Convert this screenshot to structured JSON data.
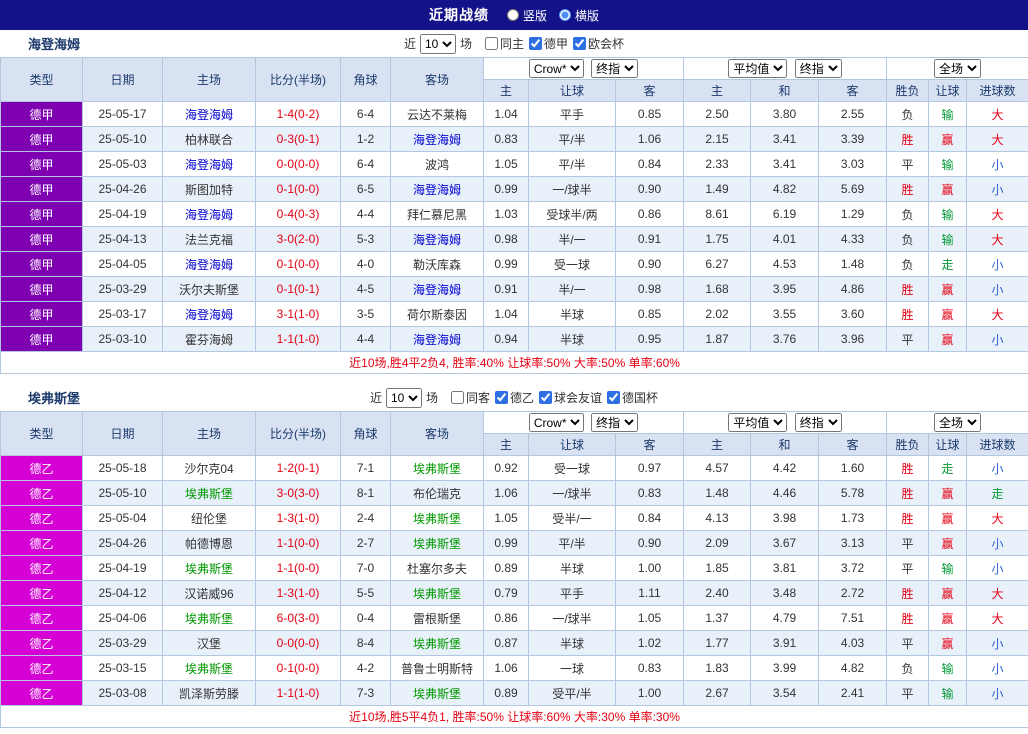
{
  "topbar": {
    "title": "近期战绩",
    "layout_options": [
      "竖版",
      "横版"
    ],
    "selected": "横版"
  },
  "colors": {
    "topbar_bg": "#141289",
    "score": "#e60012",
    "summary_text": "#e60012",
    "league_badge": {
      "德甲": "#7e00b0",
      "德乙": "#d400d4"
    },
    "team_highlight": {
      "海登海姆": "#0000d0",
      "埃弗斯堡": "#009900"
    },
    "outcome": {
      "胜": "#e60012",
      "平": "#333333",
      "负": "#333333",
      "赢": "#e60012",
      "输": "#009933",
      "走": "#009933",
      "大": "#e60012",
      "小": "#2d62d8"
    }
  },
  "table_header": {
    "col_type": "类型",
    "col_date": "日期",
    "col_home": "主场",
    "col_score": "比分(半场)",
    "col_corner": "角球",
    "col_away": "客场",
    "odds_cols": [
      "主",
      "让球",
      "客"
    ],
    "avg_cols": [
      "主",
      "和",
      "客"
    ],
    "result_cols": [
      "胜负",
      "让球",
      "进球数"
    ],
    "dd_odds_source": "Crow*",
    "dd_odds_stage": "终指",
    "dd_avg": "平均值",
    "dd_avg_stage": "终指",
    "dd_scope": "全场"
  },
  "sections": [
    {
      "team": "海登海姆",
      "filter": {
        "prefix": "近",
        "count": "10",
        "suffix": "场",
        "checkboxes": [
          {
            "label": "同主",
            "checked": false
          },
          {
            "label": "德甲",
            "checked": true
          },
          {
            "label": "欧会杯",
            "checked": true
          }
        ]
      },
      "rows": [
        {
          "league": "德甲",
          "date": "25-05-17",
          "home": "海登海姆",
          "score": "1-4(0-2)",
          "corner": "6-4",
          "away": "云达不莱梅",
          "odds": [
            "1.04",
            "平手",
            "0.85"
          ],
          "avg": [
            "2.50",
            "3.80",
            "2.55"
          ],
          "result": "负",
          "handicap": "输",
          "goal": "大"
        },
        {
          "league": "德甲",
          "date": "25-05-10",
          "home": "柏林联合",
          "score": "0-3(0-1)",
          "corner": "1-2",
          "away": "海登海姆",
          "odds": [
            "0.83",
            "平/半",
            "1.06"
          ],
          "avg": [
            "2.15",
            "3.41",
            "3.39"
          ],
          "result": "胜",
          "handicap": "赢",
          "goal": "大"
        },
        {
          "league": "德甲",
          "date": "25-05-03",
          "home": "海登海姆",
          "score": "0-0(0-0)",
          "corner": "6-4",
          "away": "波鸿",
          "odds": [
            "1.05",
            "平/半",
            "0.84"
          ],
          "avg": [
            "2.33",
            "3.41",
            "3.03"
          ],
          "result": "平",
          "handicap": "输",
          "goal": "小"
        },
        {
          "league": "德甲",
          "date": "25-04-26",
          "home": "斯图加特",
          "score": "0-1(0-0)",
          "corner": "6-5",
          "away": "海登海姆",
          "odds": [
            "0.99",
            "一/球半",
            "0.90"
          ],
          "avg": [
            "1.49",
            "4.82",
            "5.69"
          ],
          "result": "胜",
          "handicap": "赢",
          "goal": "小"
        },
        {
          "league": "德甲",
          "date": "25-04-19",
          "home": "海登海姆",
          "score": "0-4(0-3)",
          "corner": "4-4",
          "away": "拜仁慕尼黑",
          "odds": [
            "1.03",
            "受球半/两",
            "0.86"
          ],
          "avg": [
            "8.61",
            "6.19",
            "1.29"
          ],
          "result": "负",
          "handicap": "输",
          "goal": "大"
        },
        {
          "league": "德甲",
          "date": "25-04-13",
          "home": "法兰克福",
          "score": "3-0(2-0)",
          "corner": "5-3",
          "away": "海登海姆",
          "odds": [
            "0.98",
            "半/一",
            "0.91"
          ],
          "avg": [
            "1.75",
            "4.01",
            "4.33"
          ],
          "result": "负",
          "handicap": "输",
          "goal": "大"
        },
        {
          "league": "德甲",
          "date": "25-04-05",
          "home": "海登海姆",
          "score": "0-1(0-0)",
          "corner": "4-0",
          "away": "勒沃库森",
          "odds": [
            "0.99",
            "受一球",
            "0.90"
          ],
          "avg": [
            "6.27",
            "4.53",
            "1.48"
          ],
          "result": "负",
          "handicap": "走",
          "goal": "小"
        },
        {
          "league": "德甲",
          "date": "25-03-29",
          "home": "沃尔夫斯堡",
          "score": "0-1(0-1)",
          "corner": "4-5",
          "away": "海登海姆",
          "odds": [
            "0.91",
            "半/一",
            "0.98"
          ],
          "avg": [
            "1.68",
            "3.95",
            "4.86"
          ],
          "result": "胜",
          "handicap": "赢",
          "goal": "小"
        },
        {
          "league": "德甲",
          "date": "25-03-17",
          "home": "海登海姆",
          "score": "3-1(1-0)",
          "corner": "3-5",
          "away": "荷尔斯泰因",
          "odds": [
            "1.04",
            "半球",
            "0.85"
          ],
          "avg": [
            "2.02",
            "3.55",
            "3.60"
          ],
          "result": "胜",
          "handicap": "赢",
          "goal": "大"
        },
        {
          "league": "德甲",
          "date": "25-03-10",
          "home": "霍芬海姆",
          "score": "1-1(1-0)",
          "corner": "4-4",
          "away": "海登海姆",
          "odds": [
            "0.94",
            "半球",
            "0.95"
          ],
          "avg": [
            "1.87",
            "3.76",
            "3.96"
          ],
          "result": "平",
          "handicap": "赢",
          "goal": "小"
        }
      ],
      "summary": "近10场,胜4平2负4, 胜率:40% 让球率:50% 大率:50% 单率:60%"
    },
    {
      "team": "埃弗斯堡",
      "filter": {
        "prefix": "近",
        "count": "10",
        "suffix": "场",
        "checkboxes": [
          {
            "label": "同客",
            "checked": false
          },
          {
            "label": "德乙",
            "checked": true
          },
          {
            "label": "球会友谊",
            "checked": true
          },
          {
            "label": "德国杯",
            "checked": true
          }
        ]
      },
      "rows": [
        {
          "league": "德乙",
          "date": "25-05-18",
          "home": "沙尔克04",
          "score": "1-2(0-1)",
          "corner": "7-1",
          "away": "埃弗斯堡",
          "odds": [
            "0.92",
            "受一球",
            "0.97"
          ],
          "avg": [
            "4.57",
            "4.42",
            "1.60"
          ],
          "result": "胜",
          "handicap": "走",
          "goal": "小"
        },
        {
          "league": "德乙",
          "date": "25-05-10",
          "home": "埃弗斯堡",
          "score": "3-0(3-0)",
          "corner": "8-1",
          "away": "布伦瑞克",
          "odds": [
            "1.06",
            "一/球半",
            "0.83"
          ],
          "avg": [
            "1.48",
            "4.46",
            "5.78"
          ],
          "result": "胜",
          "handicap": "赢",
          "goal": "走"
        },
        {
          "league": "德乙",
          "date": "25-05-04",
          "home": "纽伦堡",
          "score": "1-3(1-0)",
          "corner": "2-4",
          "away": "埃弗斯堡",
          "odds": [
            "1.05",
            "受半/一",
            "0.84"
          ],
          "avg": [
            "4.13",
            "3.98",
            "1.73"
          ],
          "result": "胜",
          "handicap": "赢",
          "goal": "大"
        },
        {
          "league": "德乙",
          "date": "25-04-26",
          "home": "帕德博恩",
          "score": "1-1(0-0)",
          "corner": "2-7",
          "away": "埃弗斯堡",
          "odds": [
            "0.99",
            "平/半",
            "0.90"
          ],
          "avg": [
            "2.09",
            "3.67",
            "3.13"
          ],
          "result": "平",
          "handicap": "赢",
          "goal": "小"
        },
        {
          "league": "德乙",
          "date": "25-04-19",
          "home": "埃弗斯堡",
          "score": "1-1(0-0)",
          "corner": "7-0",
          "away": "杜塞尔多夫",
          "odds": [
            "0.89",
            "半球",
            "1.00"
          ],
          "avg": [
            "1.85",
            "3.81",
            "3.72"
          ],
          "result": "平",
          "handicap": "输",
          "goal": "小"
        },
        {
          "league": "德乙",
          "date": "25-04-12",
          "home": "汉诺威96",
          "score": "1-3(1-0)",
          "corner": "5-5",
          "away": "埃弗斯堡",
          "odds": [
            "0.79",
            "平手",
            "1.11"
          ],
          "avg": [
            "2.40",
            "3.48",
            "2.72"
          ],
          "result": "胜",
          "handicap": "赢",
          "goal": "大"
        },
        {
          "league": "德乙",
          "date": "25-04-06",
          "home": "埃弗斯堡",
          "score": "6-0(3-0)",
          "corner": "0-4",
          "away": "雷根斯堡",
          "odds": [
            "0.86",
            "一/球半",
            "1.05"
          ],
          "avg": [
            "1.37",
            "4.79",
            "7.51"
          ],
          "result": "胜",
          "handicap": "赢",
          "goal": "大"
        },
        {
          "league": "德乙",
          "date": "25-03-29",
          "home": "汉堡",
          "score": "0-0(0-0)",
          "corner": "8-4",
          "away": "埃弗斯堡",
          "odds": [
            "0.87",
            "半球",
            "1.02"
          ],
          "avg": [
            "1.77",
            "3.91",
            "4.03"
          ],
          "result": "平",
          "handicap": "赢",
          "goal": "小"
        },
        {
          "league": "德乙",
          "date": "25-03-15",
          "home": "埃弗斯堡",
          "score": "0-1(0-0)",
          "corner": "4-2",
          "away": "普鲁士明斯特",
          "odds": [
            "1.06",
            "一球",
            "0.83"
          ],
          "avg": [
            "1.83",
            "3.99",
            "4.82"
          ],
          "result": "负",
          "handicap": "输",
          "goal": "小"
        },
        {
          "league": "德乙",
          "date": "25-03-08",
          "home": "凯泽斯劳滕",
          "score": "1-1(1-0)",
          "corner": "7-3",
          "away": "埃弗斯堡",
          "odds": [
            "0.89",
            "受平/半",
            "1.00"
          ],
          "avg": [
            "2.67",
            "3.54",
            "2.41"
          ],
          "result": "平",
          "handicap": "输",
          "goal": "小"
        }
      ],
      "summary": "近10场,胜5平4负1, 胜率:50% 让球率:60% 大率:30% 单率:30%"
    }
  ]
}
